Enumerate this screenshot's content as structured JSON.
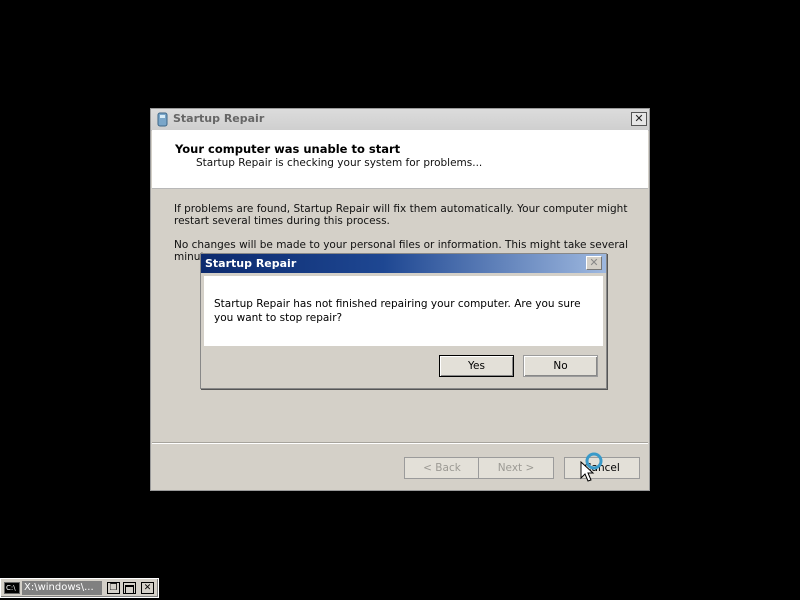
{
  "main_window": {
    "title": "Startup Repair",
    "close_glyph": "✕",
    "header_title": "Your computer was unable to start",
    "header_subtitle": "Startup Repair is checking your system for problems...",
    "paragraph1": "If problems are found, Startup Repair will fix them automatically. Your computer might restart several times during this process.",
    "paragraph2": "No changes will be made to your personal files or information. This might take several minutes.",
    "buttons": {
      "back": "< Back",
      "next": "Next >",
      "cancel": "Cancel"
    }
  },
  "dialog": {
    "title": "Startup Repair",
    "close_glyph": "✕",
    "message": "Startup Repair has not finished repairing your computer. Are you sure you want to stop repair?",
    "buttons": {
      "yes": "Yes",
      "no": "No"
    }
  },
  "taskbar": {
    "icon_label": "C:\\",
    "title": "X:\\windows\\...",
    "restore_glyph": "❐",
    "close_glyph": "✕"
  },
  "icons": [
    "startup-repair-icon",
    "close-icon",
    "console-icon",
    "mouse-cursor-icon",
    "busy-spinner-icon"
  ],
  "colors": {
    "desktop": "#000000",
    "dialog_titlebar_start": "#0c2a6e",
    "dialog_titlebar_end": "#9eb8df",
    "window_face": "#d4d0c8"
  }
}
